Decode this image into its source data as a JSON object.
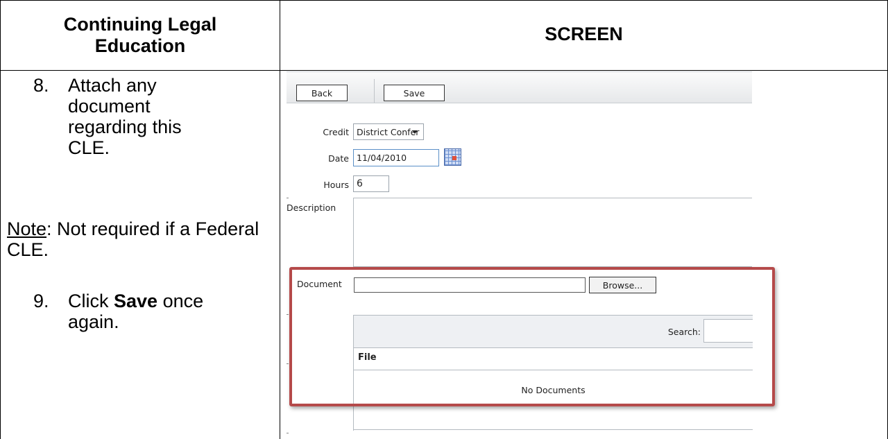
{
  "header": {
    "left_title": "Continuing Legal Education",
    "right_title": "SCREEN"
  },
  "instructions": {
    "step8_num": "8.",
    "step8_text": "Attach any document regarding this CLE.",
    "note_label": "Note",
    "note_text": ":  Not required if a Federal CLE.",
    "step9_num": "9.",
    "step9_pre": "Click ",
    "step9_bold": "Save",
    "step9_post": " once again."
  },
  "screen": {
    "toolbar": {
      "back_label": "Back",
      "save_label": "Save"
    },
    "form": {
      "credit_label": "Credit",
      "credit_value": "District Confer",
      "date_label": "Date",
      "date_value": "11/04/2010",
      "hours_label": "Hours",
      "hours_value": "6",
      "description_label": "Description",
      "document_label": "Document",
      "browse_label": "Browse..."
    },
    "documents_grid": {
      "search_label": "Search:",
      "column_file": "File",
      "empty_message": "No Documents"
    },
    "icons": {
      "calendar": "calendar-icon",
      "dropdown": "chevron-down-icon"
    },
    "highlight_color": "#b54a4a"
  }
}
